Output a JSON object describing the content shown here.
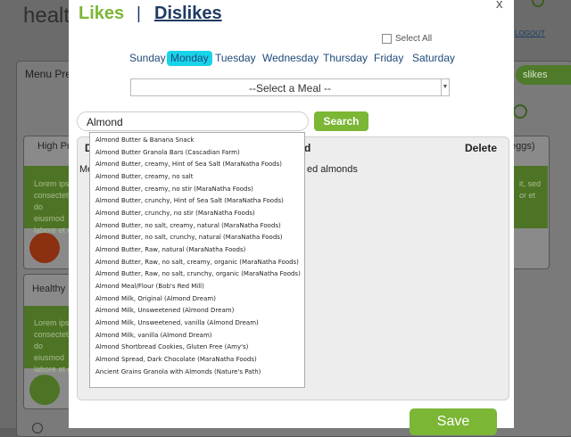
{
  "background": {
    "logo": "healt",
    "logout": "LOGOUT",
    "menu_title": "Menu Pre",
    "dislikes_pill": "slikes",
    "card1_head": "High Pr",
    "card1_text": "Lorem ips consectetur do eiusmod labore et d",
    "card2_head": "Healthy l",
    "card2_text": "Lorem ips consectetu do eiusmod labore et d",
    "right_head": "eggs)",
    "right_text": "it, sed or et"
  },
  "modal": {
    "tabs": {
      "likes": "Likes",
      "separator": "|",
      "dislikes": "Dislikes"
    },
    "close": "x",
    "select_all": "Select All",
    "days": [
      "Sunday",
      "Monday",
      "Tuesday",
      "Wednesday",
      "Thursday",
      "Friday",
      "Saturday"
    ],
    "active_day": "Monday",
    "meal_select": "--Select a Meal --",
    "search_value": "Almond",
    "search_button": "Search",
    "table": {
      "col1": "D",
      "col2": "d",
      "col3": "Delete",
      "row_left": "Me",
      "row_right": "ed almonds"
    },
    "dropdown_items": [
      "Almond Butter & Banana Snack",
      "Almond Butter Granola Bars (Cascadian Farm)",
      "Almond Butter, creamy, Hint of Sea Salt (MaraNatha Foods)",
      "Almond Butter, creamy, no salt",
      "Almond Butter, creamy, no stir  (MaraNatha Foods)",
      "Almond Butter, crunchy, Hint of Sea Salt (MaraNatha Foods)",
      "Almond Butter, crunchy, no stir (MaraNatha Foods)",
      "Almond Butter, no salt, creamy, natural (MaraNatha Foods)",
      "Almond Butter, no salt, crunchy, natural (MaraNatha Foods)",
      "Almond Butter, Raw, natural (MaraNatha Foods)",
      "Almond Butter, Raw, no salt, creamy, organic (MaraNatha Foods)",
      "Almond Butter, Raw, no salt, crunchy, organic (MaraNatha Foods)",
      "Almond Meal/Flour (Bob's Red Mill)",
      "Almond Milk, Original (Almond Dream)",
      "Almond Milk, Unsweetened (Almond Dream)",
      "Almond Milk, Unsweetened, vanilla (Almond Dream)",
      "Almond Milk, vanilla (Almond Dream)",
      "Almond Shortbread Cookies, Gluten Free (Amy's)",
      "Almond Spread, Dark Chocolate (MaraNatha Foods)",
      "Ancient Grains Granola with Almonds  (Nature's Path)"
    ],
    "save_button": "Save"
  },
  "colors": {
    "accent_green": "#7bb635",
    "active_day_bg": "#18d4ea",
    "link_blue": "#1f3b63"
  }
}
